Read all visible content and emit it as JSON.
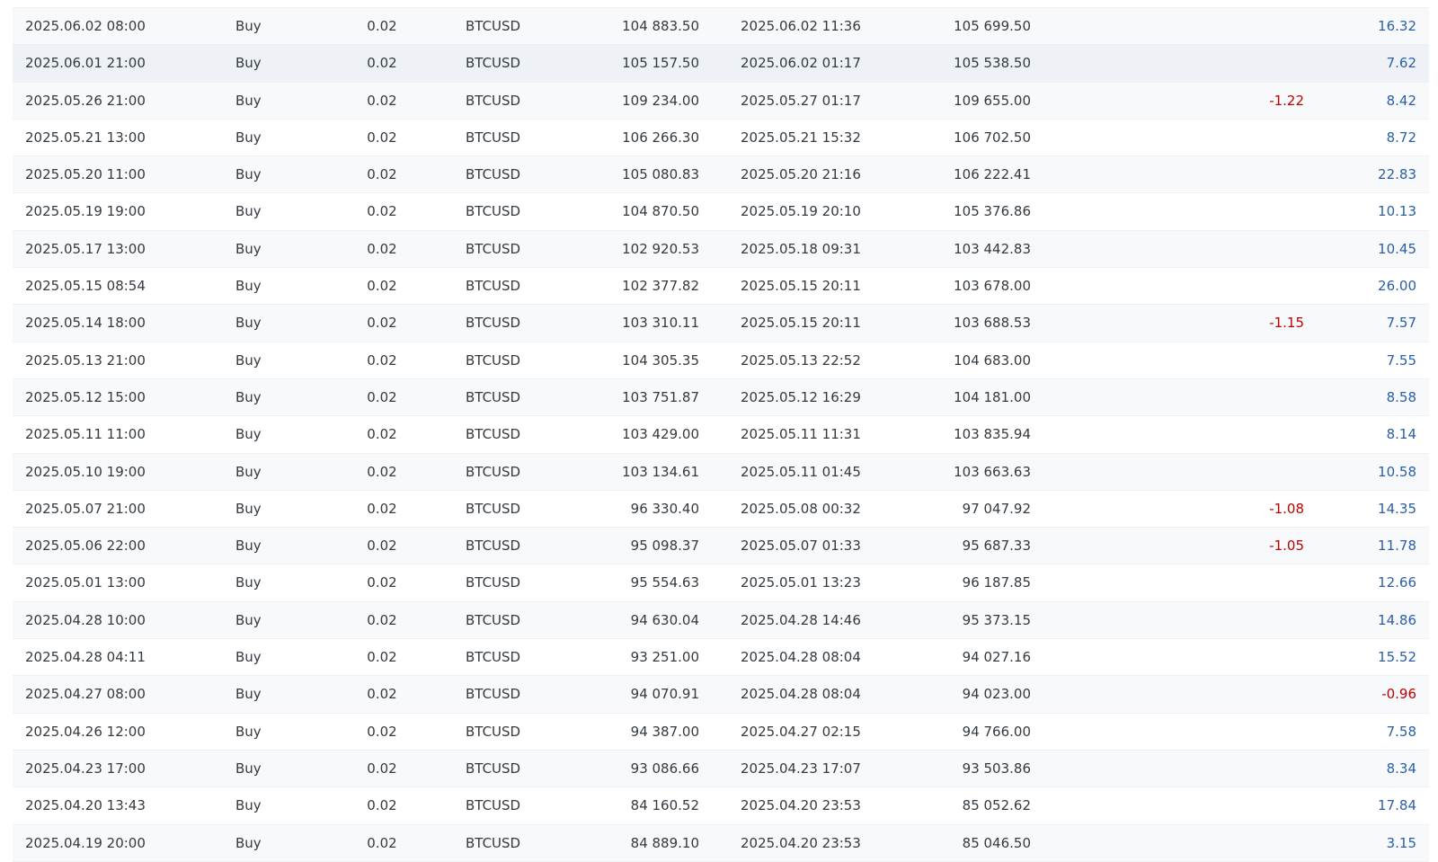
{
  "trades": [
    {
      "open_time": "2025.06.02 08:00",
      "type": "Buy",
      "volume": "0.02",
      "symbol": "BTCUSD",
      "open_price": "104 883.50",
      "close_time": "2025.06.02 11:36",
      "close_price": "105 699.50",
      "swap": "",
      "profit": "16.32"
    },
    {
      "open_time": "2025.06.01 21:00",
      "type": "Buy",
      "volume": "0.02",
      "symbol": "BTCUSD",
      "open_price": "105 157.50",
      "close_time": "2025.06.02 01:17",
      "close_price": "105 538.50",
      "swap": "",
      "profit": "7.62"
    },
    {
      "open_time": "2025.05.26 21:00",
      "type": "Buy",
      "volume": "0.02",
      "symbol": "BTCUSD",
      "open_price": "109 234.00",
      "close_time": "2025.05.27 01:17",
      "close_price": "109 655.00",
      "swap": "-1.22",
      "profit": "8.42"
    },
    {
      "open_time": "2025.05.21 13:00",
      "type": "Buy",
      "volume": "0.02",
      "symbol": "BTCUSD",
      "open_price": "106 266.30",
      "close_time": "2025.05.21 15:32",
      "close_price": "106 702.50",
      "swap": "",
      "profit": "8.72"
    },
    {
      "open_time": "2025.05.20 11:00",
      "type": "Buy",
      "volume": "0.02",
      "symbol": "BTCUSD",
      "open_price": "105 080.83",
      "close_time": "2025.05.20 21:16",
      "close_price": "106 222.41",
      "swap": "",
      "profit": "22.83"
    },
    {
      "open_time": "2025.05.19 19:00",
      "type": "Buy",
      "volume": "0.02",
      "symbol": "BTCUSD",
      "open_price": "104 870.50",
      "close_time": "2025.05.19 20:10",
      "close_price": "105 376.86",
      "swap": "",
      "profit": "10.13"
    },
    {
      "open_time": "2025.05.17 13:00",
      "type": "Buy",
      "volume": "0.02",
      "symbol": "BTCUSD",
      "open_price": "102 920.53",
      "close_time": "2025.05.18 09:31",
      "close_price": "103 442.83",
      "swap": "",
      "profit": "10.45"
    },
    {
      "open_time": "2025.05.15 08:54",
      "type": "Buy",
      "volume": "0.02",
      "symbol": "BTCUSD",
      "open_price": "102 377.82",
      "close_time": "2025.05.15 20:11",
      "close_price": "103 678.00",
      "swap": "",
      "profit": "26.00"
    },
    {
      "open_time": "2025.05.14 18:00",
      "type": "Buy",
      "volume": "0.02",
      "symbol": "BTCUSD",
      "open_price": "103 310.11",
      "close_time": "2025.05.15 20:11",
      "close_price": "103 688.53",
      "swap": "-1.15",
      "profit": "7.57"
    },
    {
      "open_time": "2025.05.13 21:00",
      "type": "Buy",
      "volume": "0.02",
      "symbol": "BTCUSD",
      "open_price": "104 305.35",
      "close_time": "2025.05.13 22:52",
      "close_price": "104 683.00",
      "swap": "",
      "profit": "7.55"
    },
    {
      "open_time": "2025.05.12 15:00",
      "type": "Buy",
      "volume": "0.02",
      "symbol": "BTCUSD",
      "open_price": "103 751.87",
      "close_time": "2025.05.12 16:29",
      "close_price": "104 181.00",
      "swap": "",
      "profit": "8.58"
    },
    {
      "open_time": "2025.05.11 11:00",
      "type": "Buy",
      "volume": "0.02",
      "symbol": "BTCUSD",
      "open_price": "103 429.00",
      "close_time": "2025.05.11 11:31",
      "close_price": "103 835.94",
      "swap": "",
      "profit": "8.14"
    },
    {
      "open_time": "2025.05.10 19:00",
      "type": "Buy",
      "volume": "0.02",
      "symbol": "BTCUSD",
      "open_price": "103 134.61",
      "close_time": "2025.05.11 01:45",
      "close_price": "103 663.63",
      "swap": "",
      "profit": "10.58"
    },
    {
      "open_time": "2025.05.07 21:00",
      "type": "Buy",
      "volume": "0.02",
      "symbol": "BTCUSD",
      "open_price": "96 330.40",
      "close_time": "2025.05.08 00:32",
      "close_price": "97 047.92",
      "swap": "-1.08",
      "profit": "14.35"
    },
    {
      "open_time": "2025.05.06 22:00",
      "type": "Buy",
      "volume": "0.02",
      "symbol": "BTCUSD",
      "open_price": "95 098.37",
      "close_time": "2025.05.07 01:33",
      "close_price": "95 687.33",
      "swap": "-1.05",
      "profit": "11.78"
    },
    {
      "open_time": "2025.05.01 13:00",
      "type": "Buy",
      "volume": "0.02",
      "symbol": "BTCUSD",
      "open_price": "95 554.63",
      "close_time": "2025.05.01 13:23",
      "close_price": "96 187.85",
      "swap": "",
      "profit": "12.66"
    },
    {
      "open_time": "2025.04.28 10:00",
      "type": "Buy",
      "volume": "0.02",
      "symbol": "BTCUSD",
      "open_price": "94 630.04",
      "close_time": "2025.04.28 14:46",
      "close_price": "95 373.15",
      "swap": "",
      "profit": "14.86"
    },
    {
      "open_time": "2025.04.28 04:11",
      "type": "Buy",
      "volume": "0.02",
      "symbol": "BTCUSD",
      "open_price": "93 251.00",
      "close_time": "2025.04.28 08:04",
      "close_price": "94 027.16",
      "swap": "",
      "profit": "15.52"
    },
    {
      "open_time": "2025.04.27 08:00",
      "type": "Buy",
      "volume": "0.02",
      "symbol": "BTCUSD",
      "open_price": "94 070.91",
      "close_time": "2025.04.28 08:04",
      "close_price": "94 023.00",
      "swap": "",
      "profit": "-0.96"
    },
    {
      "open_time": "2025.04.26 12:00",
      "type": "Buy",
      "volume": "0.02",
      "symbol": "BTCUSD",
      "open_price": "94 387.00",
      "close_time": "2025.04.27 02:15",
      "close_price": "94 766.00",
      "swap": "",
      "profit": "7.58"
    },
    {
      "open_time": "2025.04.23 17:00",
      "type": "Buy",
      "volume": "0.02",
      "symbol": "BTCUSD",
      "open_price": "93 086.66",
      "close_time": "2025.04.23 17:07",
      "close_price": "93 503.86",
      "swap": "",
      "profit": "8.34"
    },
    {
      "open_time": "2025.04.20 13:43",
      "type": "Buy",
      "volume": "0.02",
      "symbol": "BTCUSD",
      "open_price": "84 160.52",
      "close_time": "2025.04.20 23:53",
      "close_price": "85 052.62",
      "swap": "",
      "profit": "17.84"
    },
    {
      "open_time": "2025.04.19 20:00",
      "type": "Buy",
      "volume": "0.02",
      "symbol": "BTCUSD",
      "open_price": "84 889.10",
      "close_time": "2025.04.20 23:53",
      "close_price": "85 046.50",
      "swap": "",
      "profit": "3.15"
    }
  ],
  "colors": {
    "profit_positive": "#2a5fa8",
    "negative": "#c00000",
    "row_alt": "#f8f9fa",
    "row_highlight": "#eef1f6"
  }
}
